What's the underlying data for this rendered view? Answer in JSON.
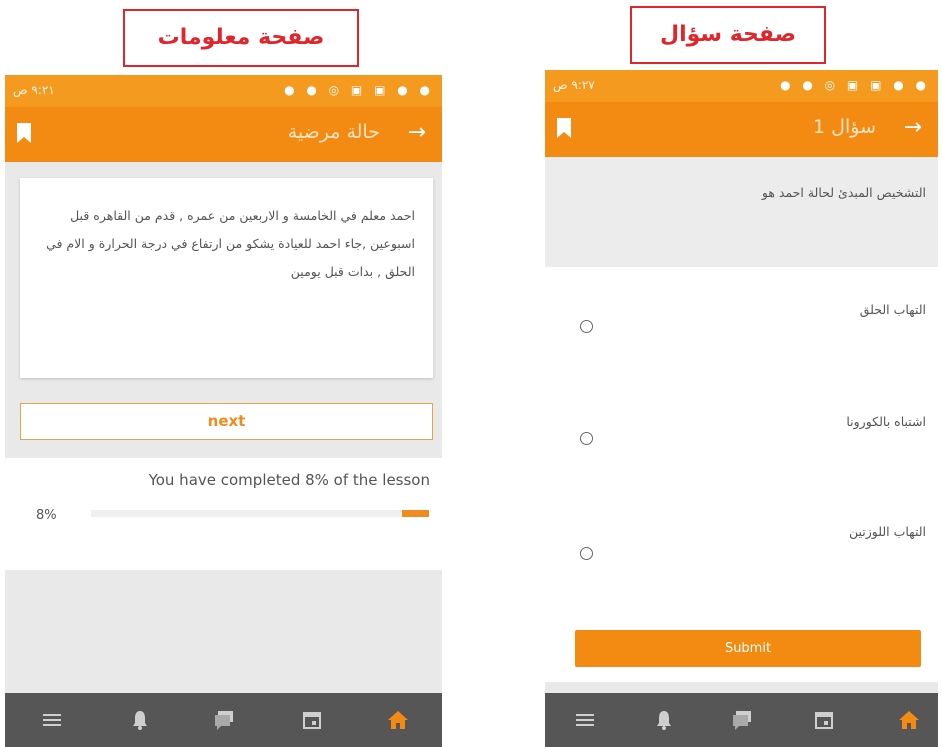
{
  "captions": {
    "info_page": "صفحة معلومات",
    "question_page": "صفحة سؤال"
  },
  "colors": {
    "accent": "#f38a12",
    "navbar": "#565656",
    "caption_border": "#e0262b"
  },
  "status_bar": {
    "time": "٩:٢١ ص",
    "time_right": "٩:٢٧ ص"
  },
  "info_screen": {
    "title": "حالة مرضية",
    "case_text": "احمد معلم في الخامسة و الاربعين من عمره , قدم من القاهره قبل اسبوعين ,جاء احمد للعيادة يشكو من ارتفاع في درجة الحرارة و الام في الحلق , بدات قبل يومين",
    "next_label": "next",
    "progress_text": "You have completed 8% of the lesson",
    "progress_label": "8%",
    "progress_value": 0.08
  },
  "question_screen": {
    "title": "سؤال 1",
    "question": "التشخيص المبدئ لحالة احمد هو",
    "options": [
      "التهاب الحلق",
      "اشتباه بالكورونا",
      "التهاب اللوزتين"
    ],
    "submit_label": "Submit"
  },
  "navbar_icons": [
    "menu-icon",
    "bell-icon",
    "chat-icon",
    "calendar-icon",
    "home-icon"
  ]
}
